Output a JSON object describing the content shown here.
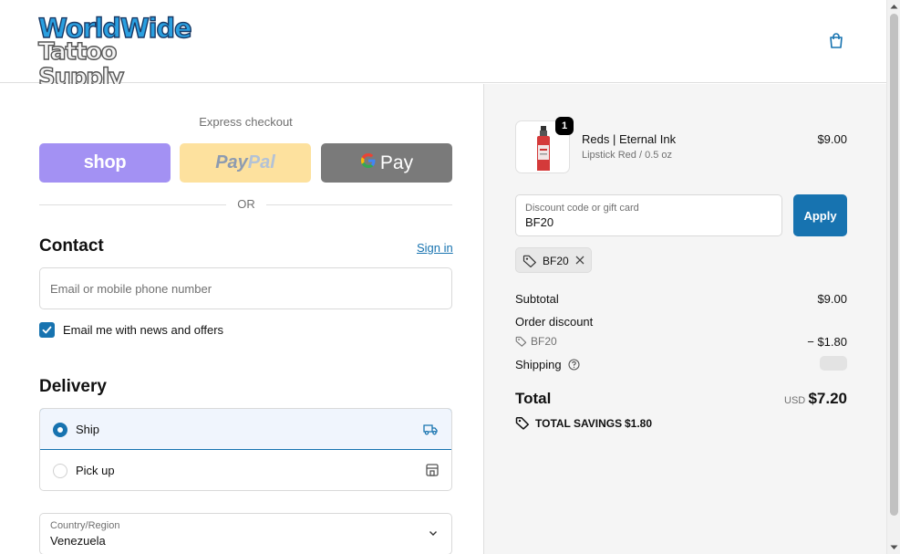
{
  "header": {
    "logo_line1": "WorldWide",
    "logo_line2": "Tattoo Supply",
    "cart_icon": "shopping-bag-icon"
  },
  "express": {
    "label": "Express checkout",
    "shop_label": "shop",
    "paypal_pay": "Pay",
    "paypal_pal": "Pal",
    "gpay_g": "G",
    "gpay_label": "Pay",
    "or_label": "OR"
  },
  "contact": {
    "title": "Contact",
    "signin_label": "Sign in",
    "email_placeholder": "Email or mobile phone number",
    "newsletter_label": "Email me with news and offers",
    "newsletter_checked": true
  },
  "delivery": {
    "title": "Delivery",
    "options": [
      {
        "label": "Ship",
        "selected": true,
        "icon": "truck-icon"
      },
      {
        "label": "Pick up",
        "selected": false,
        "icon": "store-icon"
      }
    ],
    "country_label": "Country/Region",
    "country_value": "Venezuela"
  },
  "summary": {
    "item": {
      "name": "Reds | Eternal Ink",
      "variant": "Lipstick Red / 0.5 oz",
      "price": "$9.00",
      "quantity": "1"
    },
    "discount": {
      "label": "Discount code or gift card",
      "value": "BF20",
      "apply_label": "Apply",
      "applied_code": "BF20"
    },
    "subtotal_label": "Subtotal",
    "subtotal_value": "$9.00",
    "order_discount_label": "Order discount",
    "order_discount_code": "BF20",
    "order_discount_value": "− $1.80",
    "shipping_label": "Shipping",
    "total_label": "Total",
    "total_currency": "USD",
    "total_value": "$7.20",
    "savings_label": "TOTAL SAVINGS",
    "savings_value": "$1.80"
  },
  "colors": {
    "accent": "#1773b0",
    "shop_pay": "#a391f3",
    "paypal": "#fde19e",
    "gpay": "#7a7a7a"
  }
}
